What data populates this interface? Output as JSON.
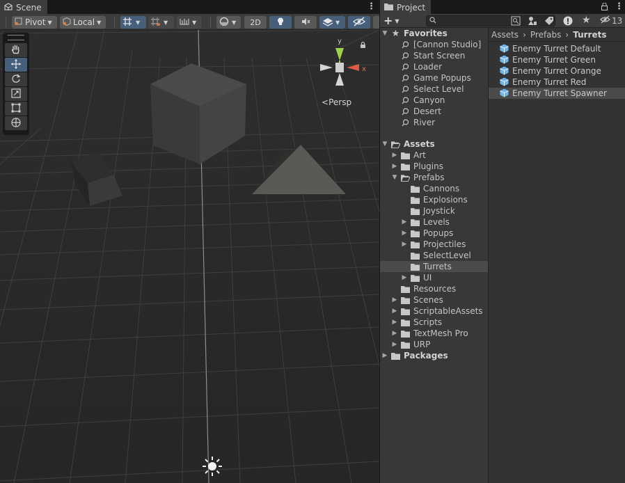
{
  "scene": {
    "tab_label": "Scene",
    "toolbar": {
      "pivot_label": "Pivot",
      "local_label": "Local",
      "mode_2d_label": "2D"
    },
    "view_label": "Persp",
    "gizmo": {
      "y_label": "y",
      "x_label": "x"
    },
    "tools": [
      "hand-tool",
      "move-tool",
      "rotate-tool",
      "scale-tool",
      "rect-tool",
      "transform-tool"
    ],
    "accent": "#46607c"
  },
  "project": {
    "tab_label": "Project",
    "hidden_count": "13",
    "favorites": {
      "label": "Favorites",
      "items": [
        "[Cannon Studio]",
        "Start Screen",
        "Loader",
        "Game Popups",
        "Select Level",
        "Canyon",
        "Desert",
        "River"
      ]
    },
    "assets": {
      "label": "Assets",
      "children": [
        {
          "label": "Art"
        },
        {
          "label": "Plugins"
        },
        {
          "label": "Prefabs"
        },
        {
          "label": "Cannons"
        },
        {
          "label": "Explosions"
        },
        {
          "label": "Joystick"
        },
        {
          "label": "Levels"
        },
        {
          "label": "Popups"
        },
        {
          "label": "Projectiles"
        },
        {
          "label": "SelectLevel"
        },
        {
          "label": "Turrets"
        },
        {
          "label": "UI"
        },
        {
          "label": "Resources"
        },
        {
          "label": "Scenes"
        },
        {
          "label": "ScriptableAssets"
        },
        {
          "label": "Scripts"
        },
        {
          "label": "TextMesh Pro"
        },
        {
          "label": "URP"
        }
      ]
    },
    "packages_label": "Packages",
    "breadcrumb": [
      "Assets",
      "Prefabs",
      "Turrets"
    ],
    "files": [
      "Enemy Turret Default",
      "Enemy Turret Green",
      "Enemy Turret Orange",
      "Enemy Turret Red",
      "Enemy Turret Spawner"
    ],
    "selected_file": "Enemy Turret Spawner",
    "selected_folder": "Turrets"
  }
}
